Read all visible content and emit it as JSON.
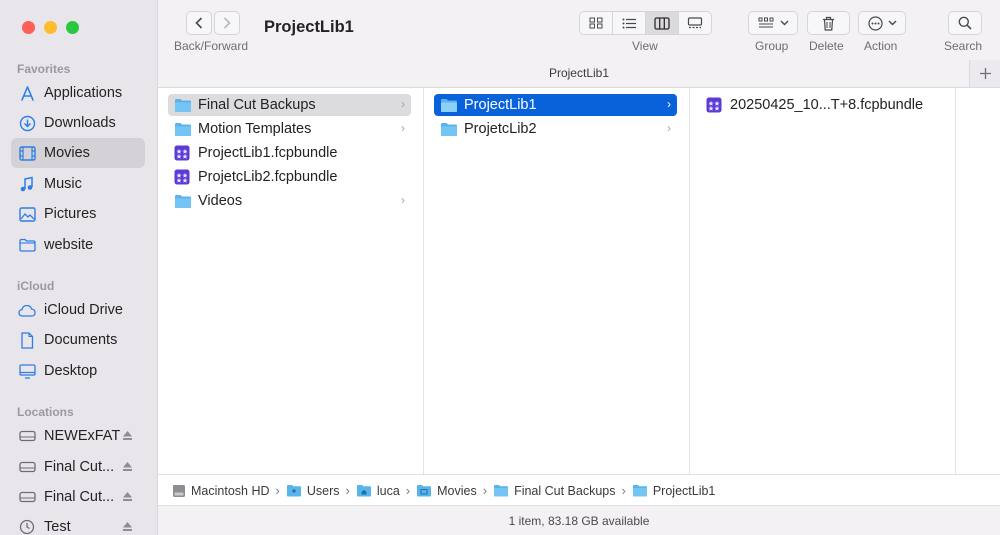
{
  "window": {
    "title": "ProjectLib1"
  },
  "sidebar": {
    "sections": [
      {
        "label": "Favorites",
        "items": [
          {
            "label": "Applications",
            "icon": "applications-icon"
          },
          {
            "label": "Downloads",
            "icon": "downloads-icon"
          },
          {
            "label": "Movies",
            "icon": "movies-icon",
            "selected": true
          },
          {
            "label": "Music",
            "icon": "music-icon"
          },
          {
            "label": "Pictures",
            "icon": "pictures-icon"
          },
          {
            "label": "website",
            "icon": "folder-icon"
          }
        ]
      },
      {
        "label": "iCloud",
        "items": [
          {
            "label": "iCloud Drive",
            "icon": "cloud-icon"
          },
          {
            "label": "Documents",
            "icon": "document-icon"
          },
          {
            "label": "Desktop",
            "icon": "desktop-icon"
          }
        ]
      },
      {
        "label": "Locations",
        "items": [
          {
            "label": "NEWExFAT",
            "icon": "drive-icon"
          },
          {
            "label": "Final Cut...",
            "icon": "drive-icon"
          },
          {
            "label": "Final Cut...",
            "icon": "drive-icon"
          },
          {
            "label": "Test",
            "icon": "clock-icon"
          }
        ]
      }
    ]
  },
  "toolbar": {
    "back_forward_label": "Back/Forward",
    "view_label": "View",
    "group_label": "Group",
    "delete_label": "Delete",
    "action_label": "Action",
    "search_label": "Search",
    "tab_title": "ProjectLib1"
  },
  "columns": {
    "col1": [
      {
        "name": "Final Cut Backups",
        "kind": "folder",
        "selected": "gray",
        "has_children": true
      },
      {
        "name": "Motion Templates",
        "kind": "folder",
        "has_children": true
      },
      {
        "name": "ProjectLib1.fcpbundle",
        "kind": "bundle"
      },
      {
        "name": "ProjetcLib2.fcpbundle",
        "kind": "bundle"
      },
      {
        "name": "Videos",
        "kind": "folder",
        "has_children": true
      }
    ],
    "col2": [
      {
        "name": "ProjectLib1",
        "kind": "folder",
        "selected": "blue",
        "has_children": true
      },
      {
        "name": "ProjetcLib2",
        "kind": "folder",
        "has_children": true
      }
    ],
    "col3": [
      {
        "name": "20250425_10...T+8.fcpbundle",
        "kind": "bundle"
      }
    ]
  },
  "pathbar": [
    "Macintosh HD",
    "Users",
    "luca",
    "Movies",
    "Final Cut Backups",
    "ProjectLib1"
  ],
  "status": {
    "text": "1 item, 83.18 GB available"
  },
  "colors": {
    "accent": "#0962da",
    "folder": "#5ab4ec",
    "bundle": "#5a3bd6"
  }
}
